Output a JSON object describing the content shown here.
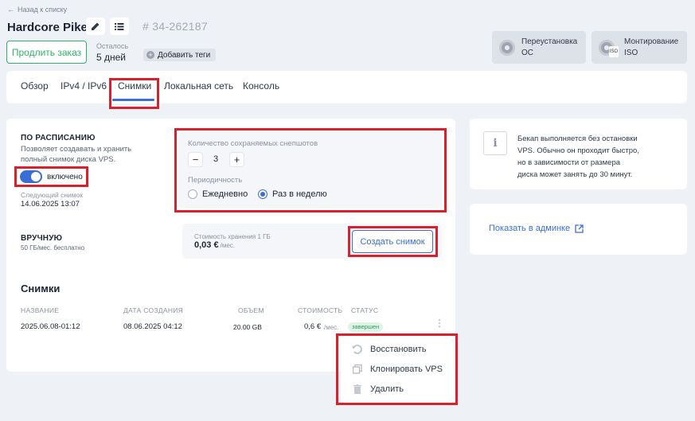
{
  "header": {
    "back_label": "Назад к списку",
    "server_name": "Hardcore Pike",
    "server_id": "# 34-262187",
    "renew_label": "Продлить заказ",
    "remaining_label": "Осталось",
    "remaining_value": "5 дней",
    "add_tags_label": "Добавить теги",
    "reinstall_label_1": "Переустановка",
    "reinstall_label_2": "ОС",
    "mount_label_1": "Монтирование",
    "mount_label_2": "ISO",
    "iso_badge": "ISO"
  },
  "tabs": [
    "Обзор",
    "IPv4 / IPv6",
    "Снимки",
    "Локальная сеть",
    "Консоль"
  ],
  "schedule": {
    "title": "ПО РАСПИСАНИЮ",
    "description_1": "Позволяет создавать и хранить",
    "description_2": "полный снимок диска VPS.",
    "toggle_label": "включено",
    "next_label": "Следующий снимок",
    "next_value": "14.06.2025 13:07",
    "count_label": "Количество сохраняемых снепшотов",
    "count_value": "3",
    "minus": "−",
    "plus": "+",
    "period_label": "Периодичность",
    "period_daily": "Ежедневно",
    "period_weekly": "Раз в неделю"
  },
  "manual": {
    "title": "ВРУЧНУЮ",
    "subtitle": "50 ГБ/мес. бесплатно",
    "cost_label": "Стоимость хранения 1 ГБ",
    "cost_value": "0,03 €",
    "cost_unit": "/мес.",
    "create_label": "Создать снимок"
  },
  "snapshots": {
    "title": "Снимки",
    "columns": [
      "НАЗВАНИЕ",
      "ДАТА СОЗДАНИЯ",
      "ОБЪЕМ",
      "СТОИМОСТЬ",
      "СТАТУС"
    ],
    "row": {
      "name": "2025.06.08-01:12",
      "date": "08.06.2025 04:12",
      "size": "20.00 GB",
      "cost": "0,6 €",
      "cost_unit": "/мес.",
      "status": "завершен"
    }
  },
  "context_menu": {
    "restore": "Восстановить",
    "clone": "Клонировать VPS",
    "delete": "Удалить"
  },
  "info": {
    "line_1": "Бекап выполняется без остановки",
    "line_2": "VPS. Обычно он проходит быстро,",
    "line_3": "но в зависимости от размера",
    "line_4": "диска может занять до 30 минут.",
    "admin_link": "Показать в админке"
  },
  "colors": {
    "accent": "#3a6ed6",
    "highlight": "#d8212d",
    "success": "#2fb26a"
  }
}
